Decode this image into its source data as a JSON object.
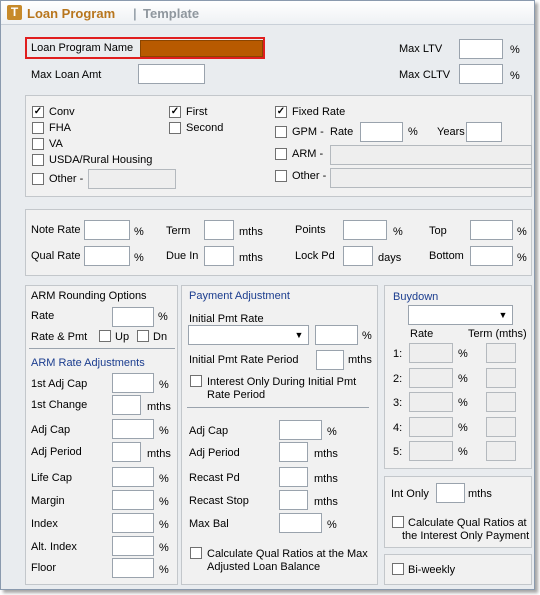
{
  "title": {
    "logo_letter": "T",
    "program": "Loan Program",
    "separator": "|",
    "template": "Template"
  },
  "header": {
    "loan_program_name": "Loan Program Name",
    "max_loan_amt": "Max Loan Amt",
    "max_ltv": "Max LTV",
    "max_cltv": "Max CLTV",
    "pct": "%",
    "name_field_color": "#b85a00",
    "highlight_color": "#e01e1e"
  },
  "types": {
    "conv": "Conv",
    "fha": "FHA",
    "va": "VA",
    "usda": "USDA/Rural Housing",
    "other": "Other -",
    "first": "First",
    "second": "Second",
    "fixed": "Fixed Rate",
    "gpm": "GPM -",
    "rate": "Rate",
    "pct": "%",
    "years": "Years",
    "arm": "ARM -",
    "other2": "Other -",
    "checked": {
      "conv": true,
      "first": true,
      "fixed": true
    }
  },
  "rates": {
    "note_rate": "Note Rate",
    "qual_rate": "Qual Rate",
    "term": "Term",
    "due_in": "Due In",
    "mths": "mths",
    "points": "Points",
    "lock_pd": "Lock Pd",
    "days": "days",
    "top": "Top",
    "bottom": "Bottom",
    "pct": "%"
  },
  "arm": {
    "rounding_title": "ARM Rounding Options",
    "rate": "Rate",
    "rate_pmt": "Rate & Pmt",
    "up": "Up",
    "dn": "Dn",
    "adj_title": "ARM Rate Adjustments",
    "first_adj_cap": "1st Adj Cap",
    "first_change": "1st Change",
    "adj_cap": "Adj Cap",
    "adj_period": "Adj Period",
    "life_cap": "Life Cap",
    "margin": "Margin",
    "index": "Index",
    "alt_index": "Alt. Index",
    "floor": "Floor",
    "pct": "%",
    "mths": "mths"
  },
  "payment": {
    "title": "Payment Adjustment",
    "initial_pmt_rate": "Initial Pmt Rate",
    "pct": "%",
    "initial_pmt_rate_period": "Initial Pmt Rate Period",
    "mths": "mths",
    "interest_only_line1": "Interest Only During Initial Pmt",
    "interest_only_line2": "Rate Period",
    "adj_cap": "Adj Cap",
    "adj_period": "Adj Period",
    "recast_pd": "Recast Pd",
    "recast_stop": "Recast Stop",
    "max_bal": "Max Bal",
    "calc_line1": "Calculate Qual Ratios at the Max",
    "calc_line2": "Adjusted Loan Balance"
  },
  "buydown": {
    "title": "Buydown",
    "rate_col": "Rate",
    "term_col": "Term (mths)",
    "pct": "%",
    "rows": [
      "1:",
      "2:",
      "3:",
      "4:",
      "5:"
    ]
  },
  "int_only": {
    "label": "Int Only",
    "mths": "mths",
    "calc_line1": "Calculate Qual Ratios at",
    "calc_line2": "the Interest Only Payment"
  },
  "biweekly": {
    "label": "Bi-weekly"
  },
  "check_glyph": "✓"
}
